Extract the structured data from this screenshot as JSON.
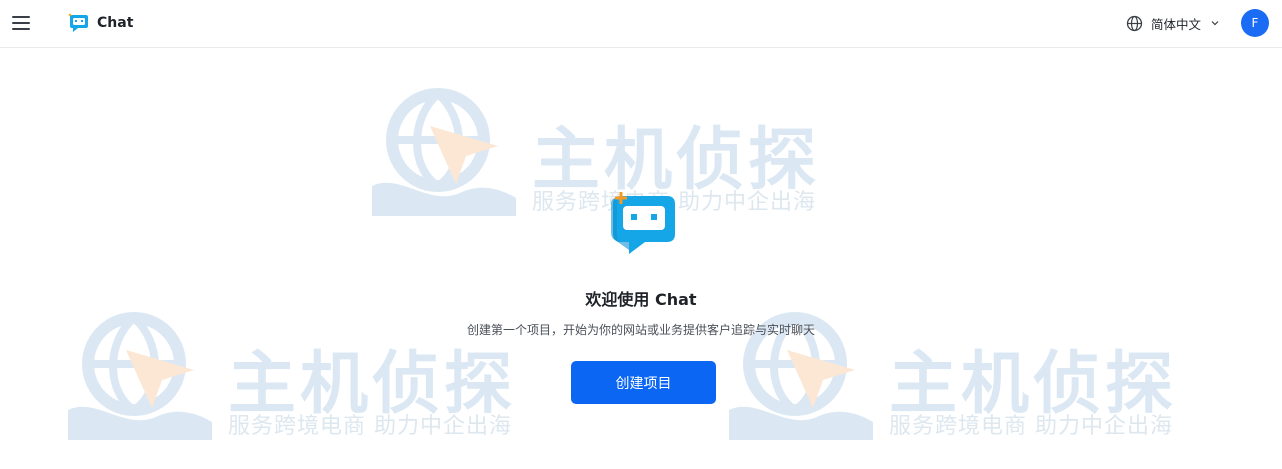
{
  "header": {
    "brand_name": "Chat",
    "language": "简体中文",
    "avatar_initial": "F"
  },
  "watermark": {
    "title": "主机侦探",
    "subtitle": "服务跨境电商 助力中企出海"
  },
  "main": {
    "welcome": "欢迎使用 Chat",
    "description": "创建第一个项目，开始为你的网站或业务提供客户追踪与实时聊天",
    "create_button": "创建项目"
  },
  "colors": {
    "accent": "#0b66f4",
    "logo": "#15a6e8",
    "avatar": "#1a6cf5"
  },
  "icons": [
    "menu-icon",
    "chat-logo-icon",
    "globe-icon",
    "chevron-down-icon"
  ]
}
